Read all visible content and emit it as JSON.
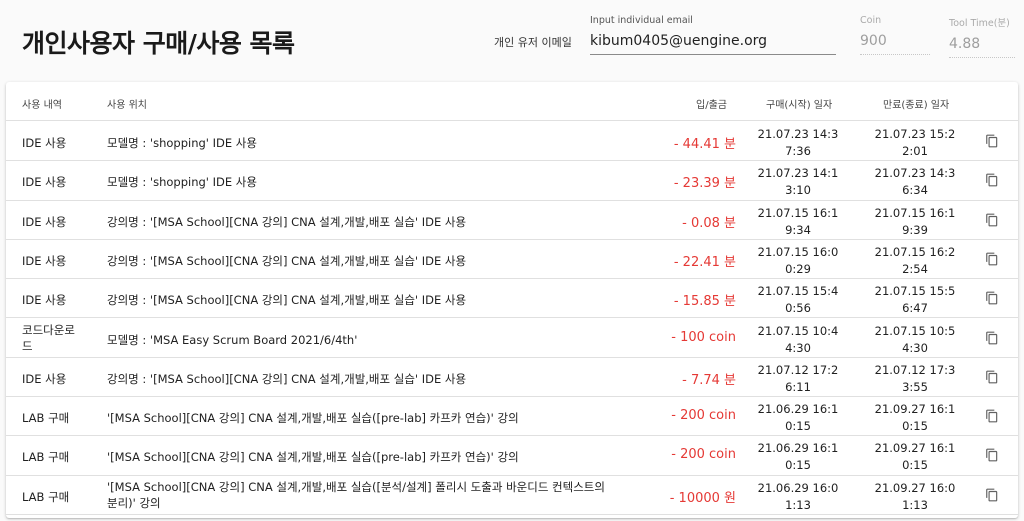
{
  "header": {
    "title": "개인사용자 구매/사용 목록",
    "email_label": "개인 유저 이메일",
    "email_field_label": "Input individual email",
    "email_value": "kibum0405@uengine.org",
    "coin_label": "Coin",
    "coin_value": "900",
    "tool_time_label": "Tool Time(분)",
    "tool_time_value": "4.88"
  },
  "table": {
    "columns": [
      "사용 내역",
      "사용 위치",
      "입/출금",
      "구매(시작) 일자",
      "만료(종료) 일자"
    ],
    "rows": [
      {
        "type": "IDE 사용",
        "location": "모델명 : 'shopping' IDE 사용",
        "amount": "- 44.41 분",
        "start": "21.07.23 14:37:36",
        "end": "21.07.23 15:22:01"
      },
      {
        "type": "IDE 사용",
        "location": "모델명 : 'shopping' IDE 사용",
        "amount": "- 23.39 분",
        "start": "21.07.23 14:13:10",
        "end": "21.07.23 14:36:34"
      },
      {
        "type": "IDE 사용",
        "location": "강의명 : '[MSA School][CNA 강의] CNA 설계,개발,배포 실습' IDE 사용",
        "amount": "- 0.08 분",
        "start": "21.07.15 16:19:34",
        "end": "21.07.15 16:19:39"
      },
      {
        "type": "IDE 사용",
        "location": "강의명 : '[MSA School][CNA 강의] CNA 설계,개발,배포 실습' IDE 사용",
        "amount": "- 22.41 분",
        "start": "21.07.15 16:00:29",
        "end": "21.07.15 16:22:54"
      },
      {
        "type": "IDE 사용",
        "location": "강의명 : '[MSA School][CNA 강의] CNA 설계,개발,배포 실습' IDE 사용",
        "amount": "- 15.85 분",
        "start": "21.07.15 15:40:56",
        "end": "21.07.15 15:56:47"
      },
      {
        "type": "코드다운로드",
        "location": "모델명 : 'MSA Easy Scrum Board 2021/6/4th'",
        "amount": "- 100 coin",
        "start": "21.07.15 10:44:30",
        "end": "21.07.15 10:54:30"
      },
      {
        "type": "IDE 사용",
        "location": "강의명 : '[MSA School][CNA 강의] CNA 설계,개발,배포 실습' IDE 사용",
        "amount": "- 7.74 분",
        "start": "21.07.12 17:26:11",
        "end": "21.07.12 17:33:55"
      },
      {
        "type": "LAB 구매",
        "location": "'[MSA School][CNA 강의] CNA 설계,개발,배포 실습([pre-lab] 카프카 연습)' 강의",
        "amount": "- 200 coin",
        "start": "21.06.29 16:10:15",
        "end": "21.09.27 16:10:15"
      },
      {
        "type": "LAB 구매",
        "location": "'[MSA School][CNA 강의] CNA 설계,개발,배포 실습([pre-lab] 카프카 연습)' 강의",
        "amount": "- 200 coin",
        "start": "21.06.29 16:10:15",
        "end": "21.09.27 16:10:15"
      },
      {
        "type": "LAB 구매",
        "location": "'[MSA School][CNA 강의] CNA 설계,개발,배포 실습([분석/설계] 폴리시 도출과 바운디드 컨텍스트의 분리)' 강의",
        "amount": "- 10000 원",
        "start": "21.06.29 16:01:13",
        "end": "21.09.27 16:01:13"
      }
    ]
  },
  "icons": {
    "row_action": "copy-icon"
  },
  "colors": {
    "amount": "#e53935"
  }
}
